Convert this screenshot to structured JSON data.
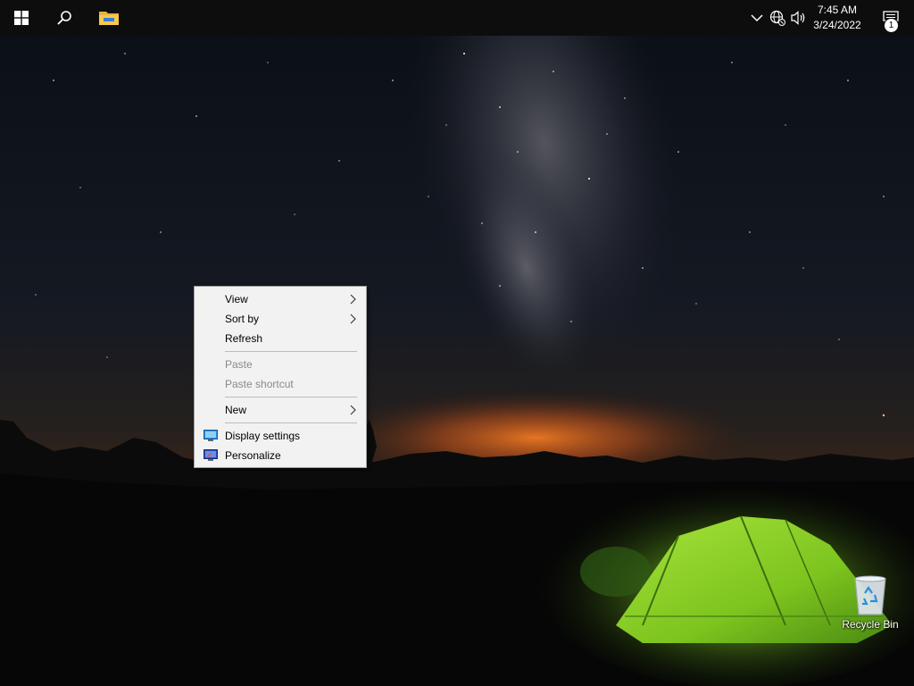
{
  "taskbar": {
    "start_icon": "windows-logo-icon",
    "search_icon": "search-icon",
    "explorer_icon": "file-explorer-icon",
    "tray": {
      "chevron_icon": "chevron-up-icon",
      "network_icon": "network-icon",
      "volume_icon": "volume-icon"
    },
    "clock": {
      "time": "7:45 AM",
      "date": "3/24/2022"
    },
    "notifications": {
      "icon": "action-center-icon",
      "count": "1"
    }
  },
  "context_menu": {
    "items": [
      {
        "label": "View",
        "submenu": true,
        "enabled": true
      },
      {
        "label": "Sort by",
        "submenu": true,
        "enabled": true
      },
      {
        "label": "Refresh",
        "submenu": false,
        "enabled": true
      },
      {
        "label": "Paste",
        "submenu": false,
        "enabled": false
      },
      {
        "label": "Paste shortcut",
        "submenu": false,
        "enabled": false
      },
      {
        "label": "New",
        "submenu": true,
        "enabled": true
      },
      {
        "label": "Display settings",
        "submenu": false,
        "enabled": true,
        "icon": "display-settings-icon"
      },
      {
        "label": "Personalize",
        "submenu": false,
        "enabled": true,
        "icon": "personalize-icon"
      }
    ]
  },
  "desktop_icons": [
    {
      "label": "Recycle Bin",
      "icon": "recycle-bin-icon"
    }
  ],
  "colors": {
    "taskbar": "#0d0d0e",
    "menu_bg": "#f2f2f2",
    "tent_green": "#7ed321",
    "horizon_glow": "#e8651a"
  }
}
